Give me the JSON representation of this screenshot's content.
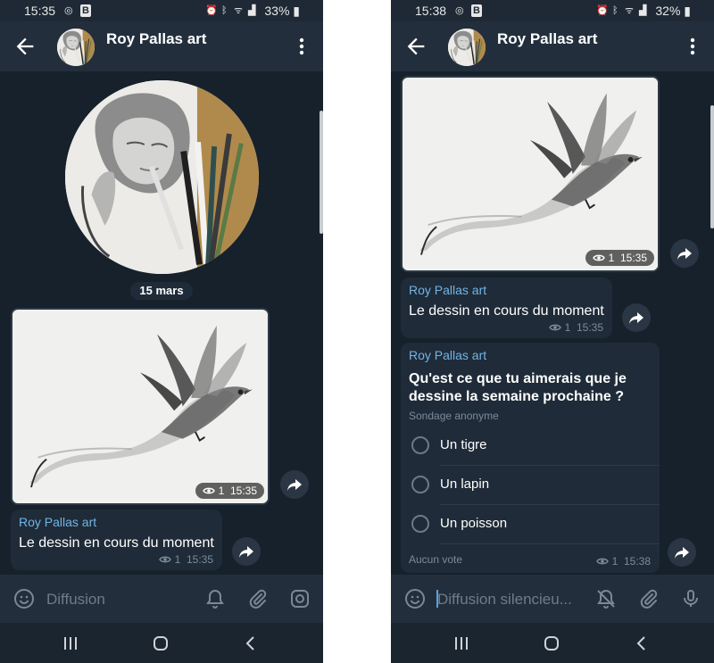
{
  "colors": {
    "chat_bg": "#17212b",
    "bar_bg": "#232e3c",
    "bubble_bg": "#1f2b38",
    "accent": "#71b5e6",
    "meta": "#7d8b99"
  },
  "left": {
    "status": {
      "time": "15:35",
      "battery": "33%"
    },
    "header": {
      "title": "Roy Pallas art"
    },
    "date_separator": "15 mars",
    "photo_meta": {
      "views": "1",
      "time": "15:35"
    },
    "message": {
      "sender": "Roy Pallas art",
      "text": "Le dessin en cours du moment",
      "views": "1",
      "time": "15:35"
    },
    "input": {
      "placeholder": "Diffusion"
    }
  },
  "right": {
    "status": {
      "time": "15:38",
      "battery": "32%"
    },
    "header": {
      "title": "Roy Pallas art"
    },
    "photo_meta": {
      "views": "1",
      "time": "15:35"
    },
    "message": {
      "sender": "Roy Pallas art",
      "text": "Le dessin en cours du moment",
      "views": "1",
      "time": "15:35"
    },
    "poll": {
      "sender": "Roy Pallas art",
      "question": "Qu'est ce que tu aimerais que je dessine la semaine prochaine ?",
      "type": "Sondage anonyme",
      "options": [
        "Un tigre",
        "Un lapin",
        "Un poisson"
      ],
      "votes": "Aucun vote",
      "views": "1",
      "time": "15:38"
    },
    "input": {
      "placeholder": "Diffusion silencieu..."
    }
  },
  "icons": [
    "back-arrow-icon",
    "more-vertical-icon",
    "share-icon",
    "eye-icon",
    "emoji-icon",
    "bell-icon",
    "bell-off-icon",
    "paperclip-icon",
    "camera-icon",
    "microphone-icon",
    "recents-icon",
    "home-icon",
    "back-nav-icon"
  ]
}
